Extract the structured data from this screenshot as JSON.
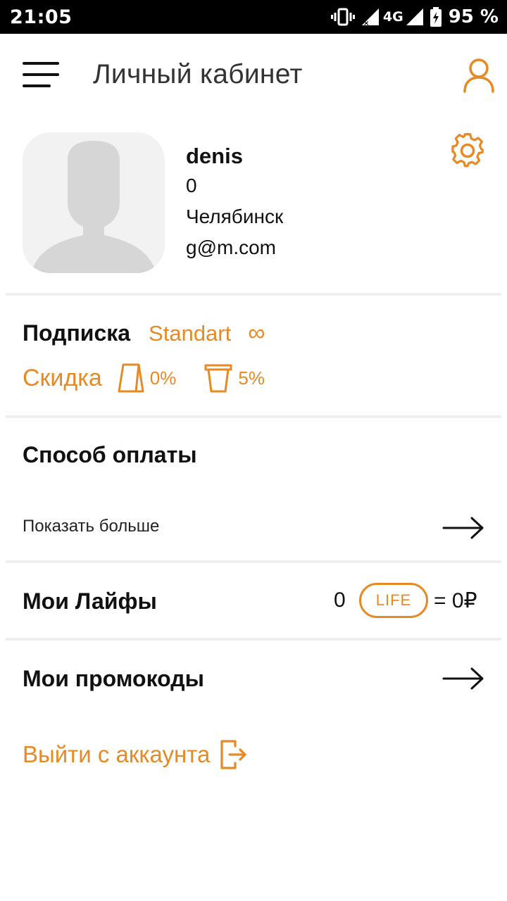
{
  "status_bar": {
    "time": "21:05",
    "network": "4G",
    "battery": "95 %"
  },
  "app_bar": {
    "title": "Личный кабинет",
    "menu_icon": "hamburger-menu-icon",
    "profile_icon": "user-icon"
  },
  "profile": {
    "name": "denis",
    "number": "0",
    "city": "Челябинск",
    "email": "g@m.com",
    "settings_icon": "gear-icon"
  },
  "subscription": {
    "label": "Подписка",
    "plan": "Standart",
    "duration": "∞",
    "discount_label": "Скидка",
    "discounts": [
      {
        "icon": "paper-bag-icon",
        "value": "0%"
      },
      {
        "icon": "cup-icon",
        "value": "5%"
      }
    ]
  },
  "payment": {
    "title": "Способ оплаты",
    "show_more": "Показать больше"
  },
  "lifes": {
    "title": "Мои Лайфы",
    "count": "0",
    "badge": "LIFE",
    "equals": "= 0₽"
  },
  "promo": {
    "title": "Мои промокоды"
  },
  "logout": {
    "label": "Выйти с аккаунта",
    "icon": "logout-icon"
  },
  "colors": {
    "accent": "#e88a24",
    "text": "#111111",
    "divider": "#eeeeee",
    "status_bar": "#000000"
  }
}
